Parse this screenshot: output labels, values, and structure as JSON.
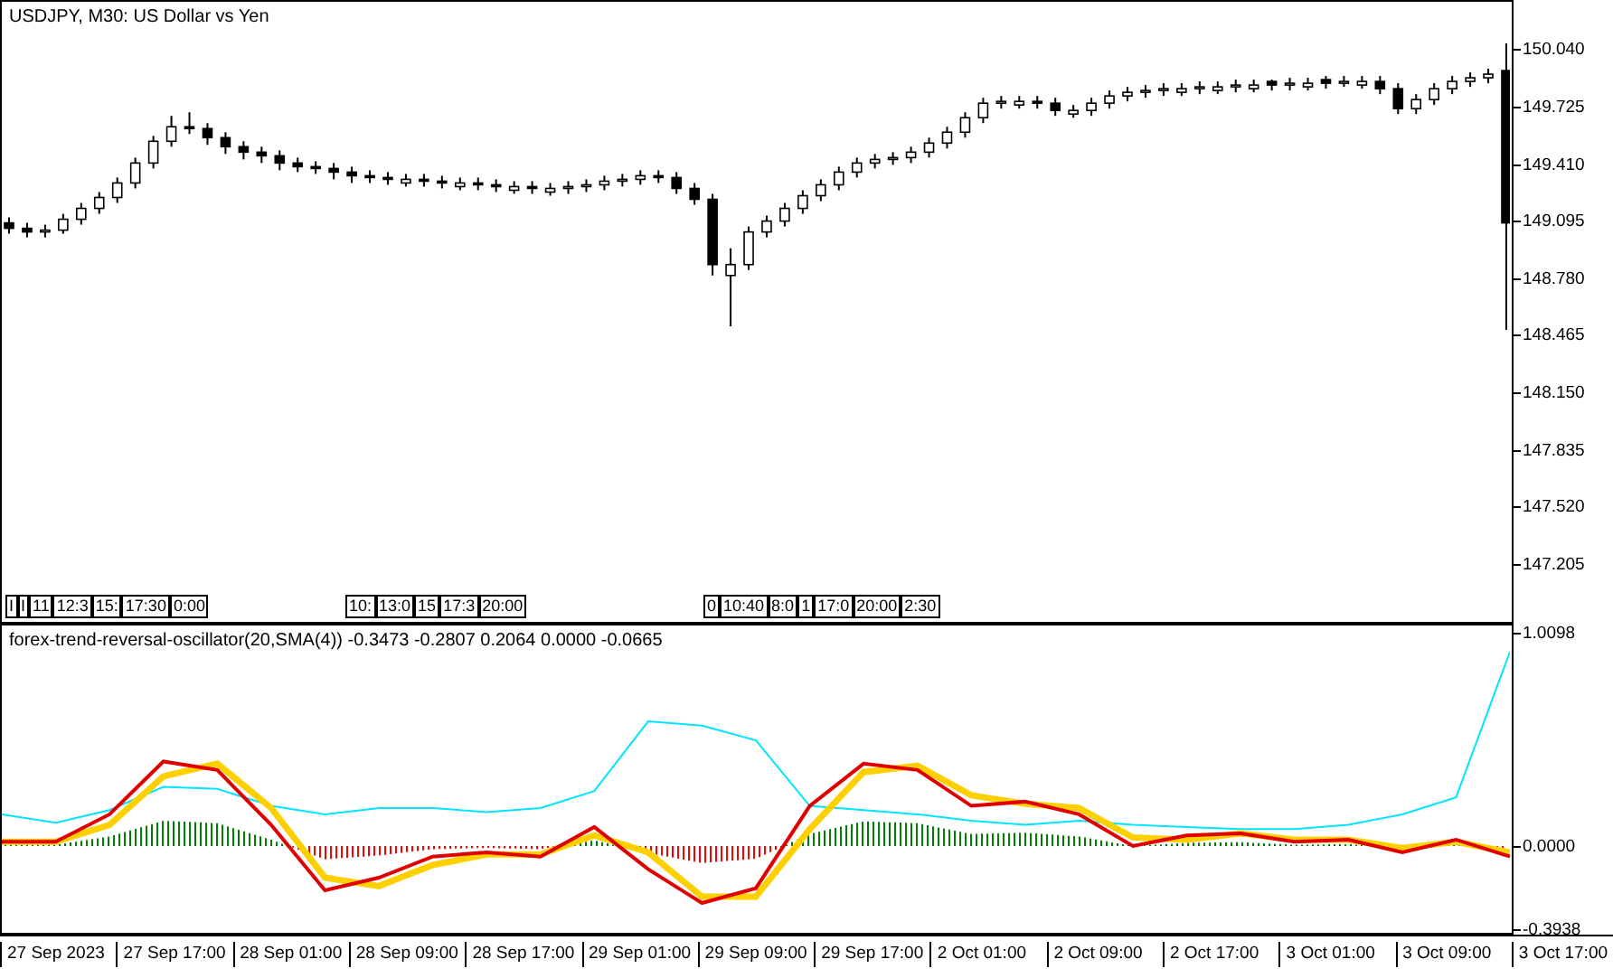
{
  "main_chart": {
    "title": "USDJPY, M30:  US Dollar vs Yen",
    "chart_data": {
      "type": "candlestick",
      "categories": [
        null,
        null,
        null,
        null,
        null,
        null,
        null,
        null,
        null,
        null,
        null,
        null,
        null,
        null,
        null,
        null,
        null,
        null,
        null,
        null,
        null,
        null,
        null,
        null,
        null,
        null,
        null,
        null,
        null,
        null,
        null,
        null,
        null,
        null,
        null,
        null,
        null,
        null,
        null,
        null,
        null,
        null,
        null,
        null,
        null,
        null,
        null,
        null,
        null,
        null,
        null,
        null,
        null,
        null,
        null,
        null,
        null,
        null,
        null,
        null,
        null,
        null,
        null,
        null,
        null,
        null,
        null,
        null,
        null,
        null,
        null,
        null,
        null,
        null,
        null,
        null,
        null,
        null,
        null,
        null,
        null,
        null,
        null,
        null
      ],
      "ohlc": [
        [
          149.09,
          149.12,
          149.03,
          149.06
        ],
        [
          149.06,
          149.09,
          149.01,
          149.04
        ],
        [
          149.04,
          149.08,
          149.01,
          149.05
        ],
        [
          149.05,
          149.14,
          149.03,
          149.11
        ],
        [
          149.11,
          149.2,
          149.08,
          149.17
        ],
        [
          149.17,
          149.26,
          149.14,
          149.23
        ],
        [
          149.23,
          149.34,
          149.2,
          149.31
        ],
        [
          149.31,
          149.45,
          149.28,
          149.42
        ],
        [
          149.42,
          149.57,
          149.39,
          149.54
        ],
        [
          149.54,
          149.68,
          149.51,
          149.62
        ],
        [
          149.62,
          149.7,
          149.58,
          149.61
        ],
        [
          149.61,
          149.64,
          149.52,
          149.56
        ],
        [
          149.56,
          149.59,
          149.47,
          149.51
        ],
        [
          149.51,
          149.54,
          149.44,
          149.48
        ],
        [
          149.48,
          149.51,
          149.42,
          149.46
        ],
        [
          149.46,
          149.49,
          149.38,
          149.42
        ],
        [
          149.42,
          149.45,
          149.37,
          149.4
        ],
        [
          149.4,
          149.43,
          149.36,
          149.39
        ],
        [
          149.39,
          149.42,
          149.33,
          149.37
        ],
        [
          149.37,
          149.4,
          149.31,
          149.35
        ],
        [
          149.35,
          149.38,
          149.31,
          149.34
        ],
        [
          149.34,
          149.37,
          149.3,
          149.33
        ],
        [
          149.31,
          149.36,
          149.29,
          149.33
        ],
        [
          149.33,
          149.36,
          149.29,
          149.32
        ],
        [
          149.32,
          149.35,
          149.28,
          149.31
        ],
        [
          149.29,
          149.34,
          149.27,
          149.31
        ],
        [
          149.31,
          149.34,
          149.27,
          149.3
        ],
        [
          149.3,
          149.33,
          149.26,
          149.29
        ],
        [
          149.27,
          149.32,
          149.25,
          149.29
        ],
        [
          149.29,
          149.32,
          149.25,
          149.28
        ],
        [
          149.26,
          149.31,
          149.24,
          149.28
        ],
        [
          149.28,
          149.32,
          149.25,
          149.29
        ],
        [
          149.29,
          149.33,
          149.26,
          149.3
        ],
        [
          149.3,
          149.35,
          149.27,
          149.32
        ],
        [
          149.32,
          149.36,
          149.29,
          149.33
        ],
        [
          149.33,
          149.38,
          149.3,
          149.35
        ],
        [
          149.35,
          149.38,
          149.31,
          149.34
        ],
        [
          149.34,
          149.37,
          149.25,
          149.28
        ],
        [
          149.28,
          149.31,
          149.19,
          149.22
        ],
        [
          149.22,
          149.25,
          148.8,
          148.86
        ],
        [
          148.8,
          148.95,
          148.52,
          148.86
        ],
        [
          148.86,
          149.07,
          148.83,
          149.04
        ],
        [
          149.04,
          149.13,
          149.01,
          149.1
        ],
        [
          149.1,
          149.2,
          149.07,
          149.17
        ],
        [
          149.17,
          149.27,
          149.14,
          149.24
        ],
        [
          149.24,
          149.33,
          149.21,
          149.3
        ],
        [
          149.3,
          149.4,
          149.27,
          149.37
        ],
        [
          149.37,
          149.45,
          149.34,
          149.42
        ],
        [
          149.42,
          149.47,
          149.39,
          149.44
        ],
        [
          149.44,
          149.48,
          149.41,
          149.45
        ],
        [
          149.45,
          149.51,
          149.42,
          149.48
        ],
        [
          149.48,
          149.56,
          149.45,
          149.53
        ],
        [
          149.53,
          149.62,
          149.5,
          149.59
        ],
        [
          149.59,
          149.7,
          149.56,
          149.67
        ],
        [
          149.67,
          149.78,
          149.64,
          149.75
        ],
        [
          149.75,
          149.79,
          149.72,
          149.76
        ],
        [
          149.74,
          149.79,
          149.72,
          149.76
        ],
        [
          149.76,
          149.79,
          149.72,
          149.75
        ],
        [
          149.75,
          149.78,
          149.68,
          149.71
        ],
        [
          149.69,
          149.74,
          149.67,
          149.71
        ],
        [
          149.71,
          149.78,
          149.68,
          149.75
        ],
        [
          149.75,
          149.82,
          149.72,
          149.79
        ],
        [
          149.79,
          149.84,
          149.76,
          149.81
        ],
        [
          149.81,
          149.85,
          149.78,
          149.82
        ],
        [
          149.82,
          149.86,
          149.79,
          149.83
        ],
        [
          149.81,
          149.86,
          149.79,
          149.83
        ],
        [
          149.83,
          149.87,
          149.8,
          149.84
        ],
        [
          149.82,
          149.87,
          149.8,
          149.84
        ],
        [
          149.84,
          149.88,
          149.81,
          149.85
        ],
        [
          149.83,
          149.88,
          149.81,
          149.85
        ],
        [
          149.87,
          149.88,
          149.82,
          149.85
        ],
        [
          149.85,
          149.89,
          149.82,
          149.86
        ],
        [
          149.84,
          149.89,
          149.82,
          149.86
        ],
        [
          149.88,
          149.9,
          149.83,
          149.86
        ],
        [
          149.86,
          149.9,
          149.84,
          149.87
        ],
        [
          149.85,
          149.9,
          149.83,
          149.87
        ],
        [
          149.87,
          149.9,
          149.8,
          149.83
        ],
        [
          149.83,
          149.86,
          149.69,
          149.72
        ],
        [
          149.72,
          149.8,
          149.69,
          149.77
        ],
        [
          149.77,
          149.86,
          149.74,
          149.83
        ],
        [
          149.83,
          149.9,
          149.8,
          149.87
        ],
        [
          149.87,
          149.92,
          149.84,
          149.89
        ],
        [
          149.89,
          149.94,
          149.86,
          149.91
        ],
        [
          149.93,
          150.08,
          148.5,
          149.09
        ]
      ],
      "ylim": [
        146.88,
        150.309
      ],
      "yticks": [
        {
          "value": 150.04,
          "label": "150.040"
        },
        {
          "value": 149.725,
          "label": "149.725"
        },
        {
          "value": 149.41,
          "label": "149.410"
        },
        {
          "value": 149.095,
          "label": "149.095"
        },
        {
          "value": 148.78,
          "label": "148.780"
        },
        {
          "value": 148.465,
          "label": "148.465"
        },
        {
          "value": 148.15,
          "label": "148.150"
        },
        {
          "value": 147.835,
          "label": "147.835"
        },
        {
          "value": 147.52,
          "label": "147.520"
        },
        {
          "value": 147.205,
          "label": "147.205"
        }
      ]
    },
    "line_tags": [
      [
        "I",
        "I",
        "11",
        "12:3",
        "15:",
        "17:30",
        "0:00"
      ],
      [
        "10:",
        "13:0",
        "15",
        "17:3",
        "20:00"
      ],
      [
        "0",
        "10:40",
        "8:0",
        "1",
        "17:0",
        "20:00",
        "2:30"
      ]
    ]
  },
  "oscillator": {
    "label": "forex-trend-reversal-oscillator(20,SMA(4)) -0.3473 -0.2807 0.2064 0.0000 -0.0665",
    "chart_data": {
      "type": "line",
      "categories": [
        null,
        null,
        null,
        null,
        null,
        null,
        null,
        null,
        null,
        null,
        null,
        null,
        null,
        null,
        null,
        null,
        null,
        null,
        null,
        null,
        null,
        null,
        null,
        null,
        null,
        null,
        null,
        null,
        null
      ],
      "series": [
        {
          "color": "#e00000",
          "values": [
            0.02,
            0.02,
            0.15,
            0.4,
            0.36,
            0.1,
            -0.21,
            -0.15,
            -0.05,
            -0.03,
            -0.05,
            0.09,
            -0.11,
            -0.27,
            -0.2,
            0.19,
            0.39,
            0.36,
            0.19,
            0.21,
            0.15,
            0.0,
            0.05,
            0.06,
            0.02,
            0.03,
            -0.03,
            0.03,
            -0.05
          ]
        },
        {
          "color": "#ffd000",
          "values": [
            0.02,
            0.02,
            0.1,
            0.33,
            0.39,
            0.18,
            -0.15,
            -0.19,
            -0.09,
            -0.04,
            -0.04,
            0.05,
            -0.03,
            -0.24,
            -0.24,
            0.08,
            0.35,
            0.38,
            0.24,
            0.2,
            0.18,
            0.04,
            0.03,
            0.06,
            0.03,
            0.03,
            -0.01,
            0.02,
            -0.03
          ]
        },
        {
          "color": "#00e5ff",
          "values": [
            0.15,
            0.11,
            0.17,
            0.28,
            0.27,
            0.19,
            0.15,
            0.18,
            0.18,
            0.16,
            0.18,
            0.26,
            0.59,
            0.57,
            0.5,
            0.19,
            0.17,
            0.15,
            0.12,
            0.1,
            0.12,
            0.1,
            0.09,
            0.08,
            0.08,
            0.1,
            0.15,
            0.23,
            0.92
          ]
        }
      ],
      "ylim": [
        -0.411,
        1.044
      ],
      "yticks": [
        {
          "value": 1.0098,
          "label": "1.0098"
        },
        {
          "value": 0,
          "label": "0.0000"
        },
        {
          "value": -0.3938,
          "label": "-0.3938"
        }
      ]
    }
  },
  "time_axis": [
    "27 Sep 2023",
    "27 Sep 17:00",
    "28 Sep 01:00",
    "28 Sep 09:00",
    "28 Sep 17:00",
    "29 Sep 01:00",
    "29 Sep 09:00",
    "29 Sep 17:00",
    "2 Oct 01:00",
    "2 Oct 09:00",
    "2 Oct 17:00",
    "3 Oct 01:00",
    "3 Oct 09:00",
    "3 Oct 17:00"
  ]
}
